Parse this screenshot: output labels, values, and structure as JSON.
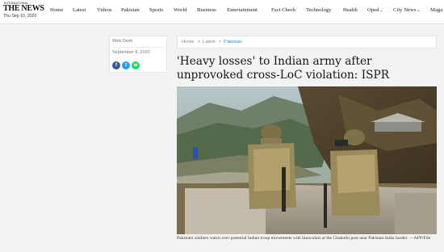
{
  "header": {
    "logo_intl": "INTERNATIONAL",
    "logo_name": "THE NEWS",
    "date": "Thu Sep 10, 2020",
    "nav": [
      {
        "label": "Home",
        "dropdown": false
      },
      {
        "label": "Latest",
        "dropdown": false
      },
      {
        "label": "Videos",
        "dropdown": false
      },
      {
        "label": "Pakistan",
        "dropdown": false
      },
      {
        "label": "Sports",
        "dropdown": false
      },
      {
        "label": "World",
        "dropdown": false
      },
      {
        "label": "Business",
        "dropdown": false
      },
      {
        "label": "Entertainment",
        "dropdown": false
      },
      {
        "label": "Fact Check",
        "dropdown": false
      },
      {
        "label": "Technology",
        "dropdown": false
      },
      {
        "label": "Health",
        "dropdown": false
      },
      {
        "label": "Oped",
        "dropdown": true
      },
      {
        "label": "City News",
        "dropdown": true
      },
      {
        "label": "Maga",
        "dropdown": false
      }
    ]
  },
  "article": {
    "author": "Web Desk",
    "date": "September 8, 2020",
    "share": [
      {
        "icon": "facebook-icon",
        "glyph": "f",
        "color": "#3b5998"
      },
      {
        "icon": "twitter-icon",
        "glyph": "t",
        "color": "#1da1f2"
      },
      {
        "icon": "whatsapp-icon",
        "glyph": "w",
        "color": "#25d366"
      }
    ],
    "breadcrumb": {
      "home": "Home",
      "sep": ">",
      "latest": "Latest",
      "current": "Pakistan"
    },
    "headline": "'Heavy losses' to Indian army after unprovoked cross-LoC violation: ISPR",
    "caption": "Pakistani soldiers watch over potential Indian troop movements with binoculars at the Chakothi post near Pakistan-India border. —AFP/File"
  },
  "colors": {
    "accent": "#2a8bc7"
  }
}
